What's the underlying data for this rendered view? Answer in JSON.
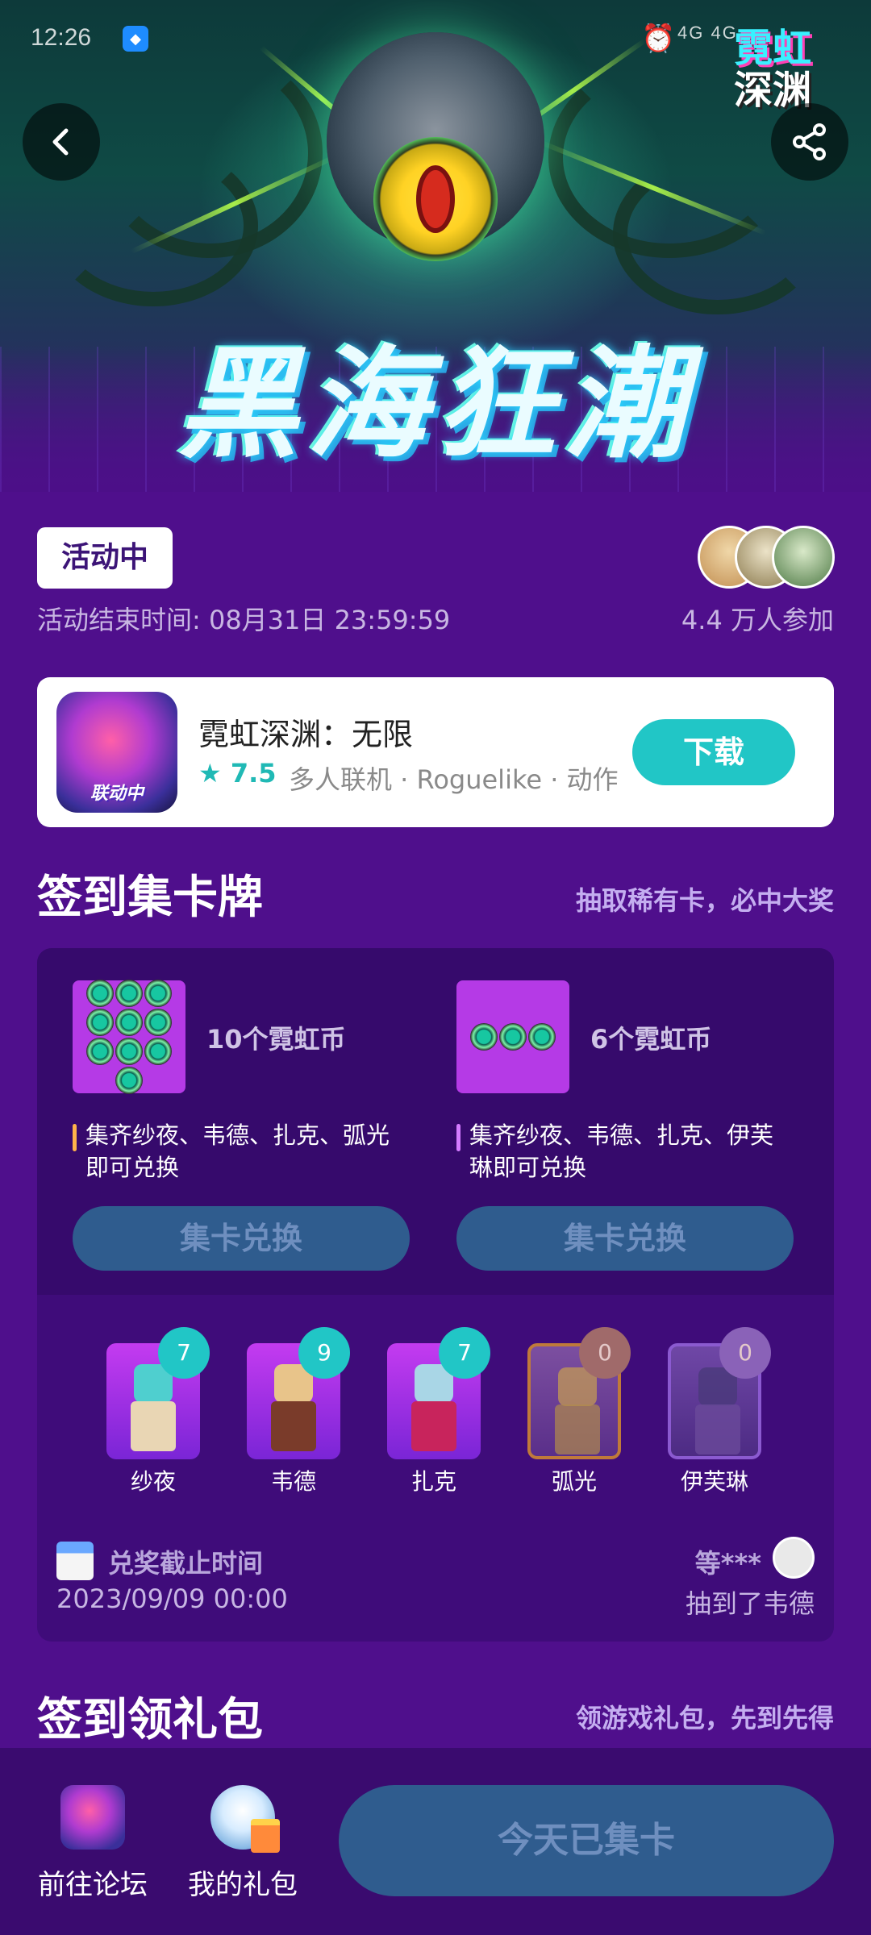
{
  "status_bar": {
    "time": "12:26",
    "network": "4G 4G"
  },
  "hero": {
    "logo_line1": "霓虹",
    "logo_line2": "深渊",
    "title": "黑海狂潮"
  },
  "event": {
    "status": "活动中",
    "end_time": "活动结束时间: 08月31日 23:59:59",
    "participants": "4.4 万人参加"
  },
  "game": {
    "icon_tag": "联动中",
    "name": "霓虹深渊：无限",
    "rating": "7.5",
    "tags": "多人联机 · Roguelike · 动作",
    "download_label": "下载"
  },
  "checkin_cards": {
    "title": "签到集卡牌",
    "subtitle": "抽取稀有卡，必中大奖",
    "rewards": [
      {
        "amount": "10个霓虹币",
        "desc": "集齐纱夜、韦德、扎克、弧光即可兑换",
        "button": "集卡兑换",
        "coins": 10
      },
      {
        "amount": "6个霓虹币",
        "desc": "集齐纱夜、韦德、扎克、伊芙琳即可兑换",
        "button": "集卡兑换",
        "coins": 3
      }
    ],
    "characters": [
      {
        "name": "纱夜",
        "count": "7"
      },
      {
        "name": "韦德",
        "count": "9"
      },
      {
        "name": "扎克",
        "count": "7"
      },
      {
        "name": "弧光",
        "count": "0"
      },
      {
        "name": "伊芙琳",
        "count": "0"
      }
    ],
    "deadline_label": "兑奖截止时间",
    "deadline_value": "2023/09/09 00:00",
    "winner_name": "等***",
    "winner_text": "抽到了韦德"
  },
  "checkin_gifts": {
    "title": "签到领礼包",
    "subtitle": "领游戏礼包，先到先得"
  },
  "bottom_bar": {
    "forum_label": "前往论坛",
    "gifts_label": "我的礼包",
    "action_label": "今天已集卡"
  },
  "colors": {
    "background": "#4f0f8c",
    "accent_teal": "#21c6c6",
    "disabled_button": "#2f5c8e"
  }
}
